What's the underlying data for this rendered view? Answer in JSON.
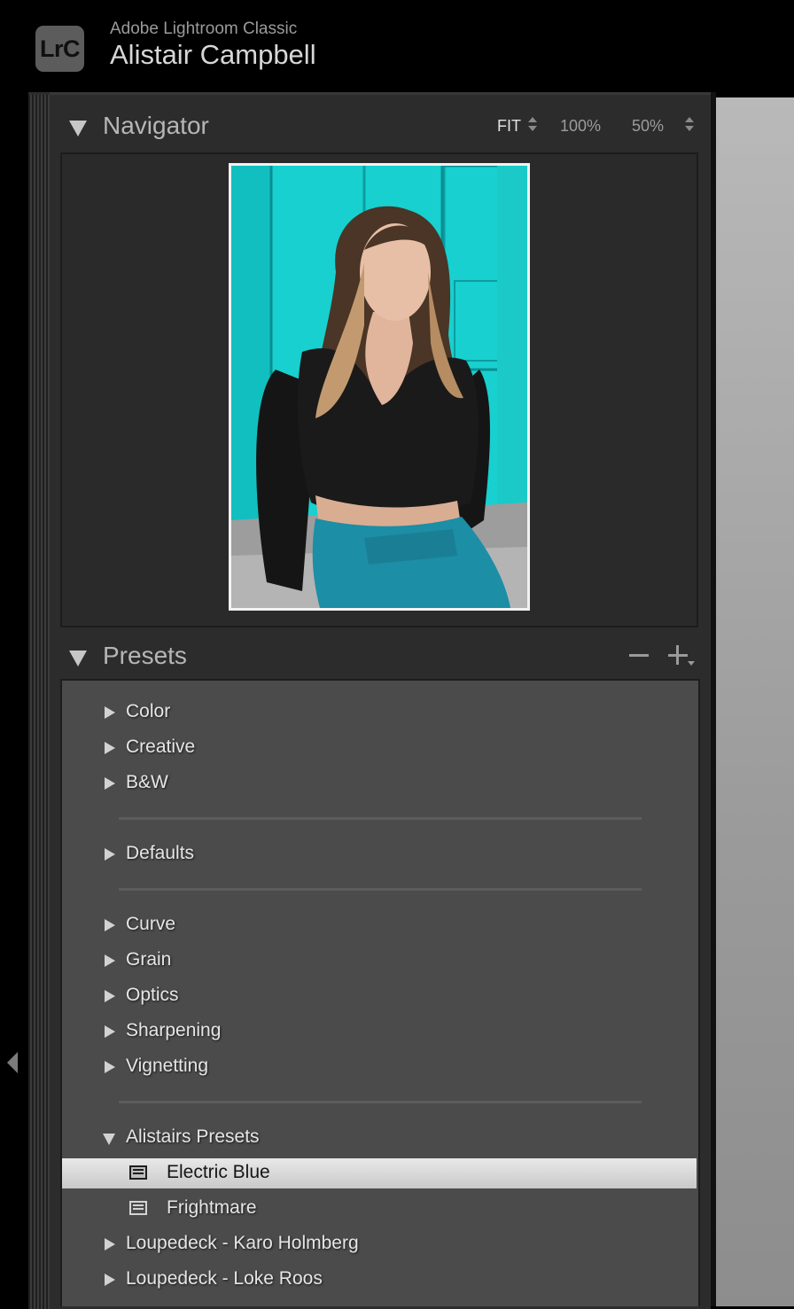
{
  "titlebar": {
    "logo_text": "LrC",
    "app_name": "Adobe Lightroom Classic",
    "user_name": "Alistair Campbell"
  },
  "navigator": {
    "title": "Navigator",
    "zoom_options": [
      "FIT",
      "100%",
      "50%"
    ],
    "active_zoom": "FIT",
    "photo": {
      "background_color": "#18d0cf",
      "top_color": "#15c4c6"
    }
  },
  "presets": {
    "title": "Presets",
    "groups": [
      {
        "label": "Color",
        "expanded": false
      },
      {
        "label": "Creative",
        "expanded": false
      },
      {
        "label": "B&W",
        "expanded": false
      },
      {
        "label": "Defaults",
        "expanded": false
      },
      {
        "label": "Curve",
        "expanded": false
      },
      {
        "label": "Grain",
        "expanded": false
      },
      {
        "label": "Optics",
        "expanded": false
      },
      {
        "label": "Sharpening",
        "expanded": false
      },
      {
        "label": "Vignetting",
        "expanded": false
      },
      {
        "label": "Alistairs Presets",
        "expanded": true
      },
      {
        "label": "Loupedeck - Karo Holmberg",
        "expanded": false
      },
      {
        "label": "Loupedeck - Loke Roos",
        "expanded": false
      }
    ],
    "user_presets": [
      {
        "label": "Electric Blue",
        "selected": true
      },
      {
        "label": "Frightmare",
        "selected": false
      }
    ]
  },
  "colors": {
    "panel_bg": "#2c2c2c",
    "list_bg": "#4b4b4b",
    "selection": "#d6d6d6"
  }
}
